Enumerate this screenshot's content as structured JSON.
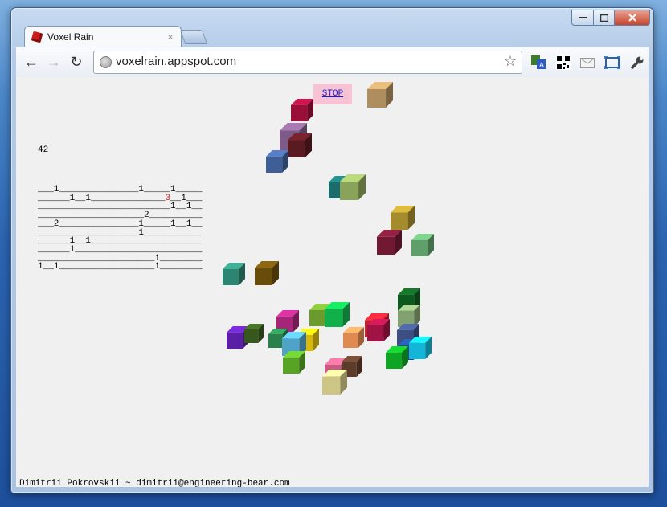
{
  "browser": {
    "tab_title": "Voxel Rain",
    "tab_close": "×",
    "url": "voxelrain.appspot.com",
    "back_icon": "←",
    "forward_icon": "→",
    "reload_icon": "↻",
    "star_icon": "☆",
    "wrench_icon": "🔧"
  },
  "page": {
    "score": "42",
    "stop_label": "STOP",
    "footer": "Dimitrii Pokrovskii ~ dimitrii@engineering-bear.com",
    "grid_rows": [
      "___1_______________1_____1_____",
      "______1__1______________3__1___",
      "_________________________1__1__",
      "____________________2__________",
      "___2_______________1_____1__1__",
      "___________________1___________",
      "______1__1_____________________",
      "______1________________________",
      "______________________1________",
      "1__1__________________1________"
    ],
    "highlight": {
      "row": 1,
      "char": "3"
    }
  },
  "cubes": [
    {
      "color": "#ae8e5e"
    },
    {
      "color": "#9a0f3a"
    },
    {
      "color": "#7e5a86"
    },
    {
      "color": "#5a1a22"
    },
    {
      "color": "#3f5e95"
    },
    {
      "color": "#1b6d6d"
    },
    {
      "color": "#8aa35a"
    },
    {
      "color": "#a48b2e"
    },
    {
      "color": "#711833"
    },
    {
      "color": "#5e9f6a"
    },
    {
      "color": "#2d8470"
    },
    {
      "color": "#6a4c0a"
    },
    {
      "color": "#6b9b2c"
    },
    {
      "color": "#11b04a"
    },
    {
      "color": "#a6257a"
    },
    {
      "color": "#c2222f"
    },
    {
      "color": "#0d5a1e"
    },
    {
      "color": "#83a070"
    },
    {
      "color": "#5b1fa6"
    },
    {
      "color": "#37581c"
    },
    {
      "color": "#29804a"
    },
    {
      "color": "#d8b90a"
    },
    {
      "color": "#4fa2c8"
    },
    {
      "color": "#3d4f80"
    },
    {
      "color": "#df8a50"
    },
    {
      "color": "#a01445"
    },
    {
      "color": "#1f4b8e"
    },
    {
      "color": "#13b6d8"
    },
    {
      "color": "#0fa524"
    },
    {
      "color": "#57a324"
    },
    {
      "color": "#c65c80"
    },
    {
      "color": "#5e3c2a"
    },
    {
      "color": "#cdc583"
    }
  ]
}
